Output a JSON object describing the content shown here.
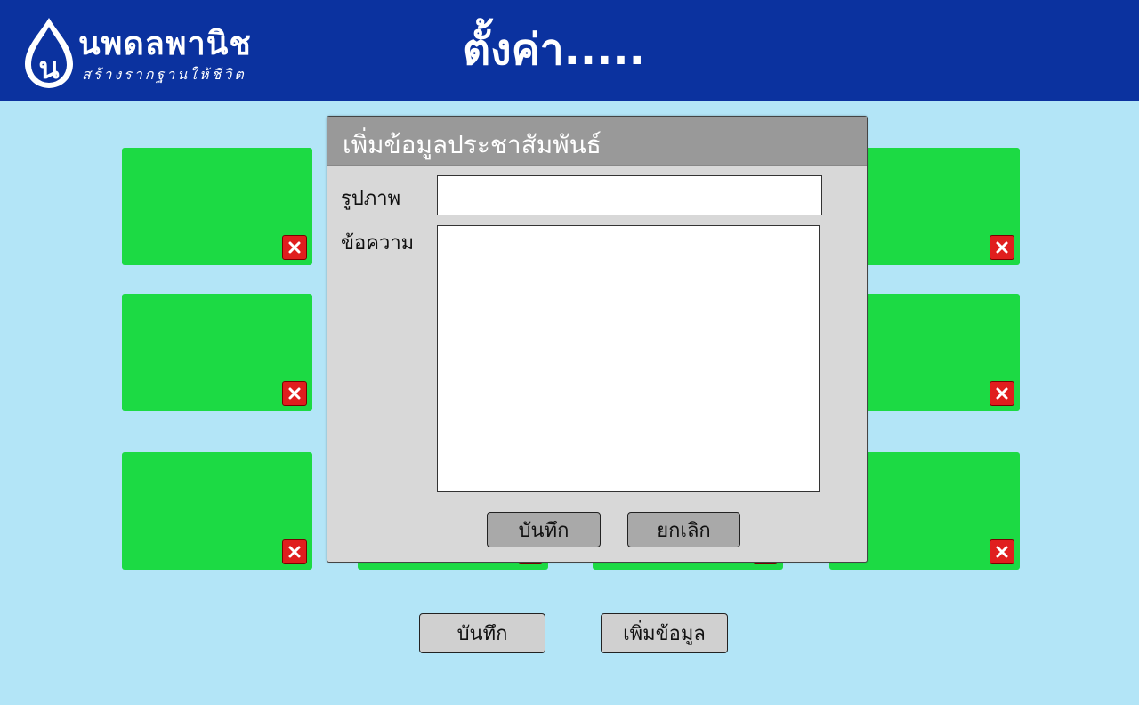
{
  "header": {
    "logo_name": "นพดลพานิช",
    "logo_tagline": "สร้างรากฐานให้ชีวิต",
    "title": "ตั้งค่า....."
  },
  "colors": {
    "header_bg": "#0b329f",
    "page_bg": "#b3e5f7",
    "card": "#1cda44",
    "delete_button": "#e01e1e",
    "dialog_titlebar": "#999999"
  },
  "cards": [
    {
      "delete_icon": "close-icon"
    },
    {
      "delete_icon": "close-icon"
    },
    {
      "delete_icon": "close-icon"
    },
    {
      "delete_icon": "close-icon"
    },
    {
      "delete_icon": "close-icon"
    },
    {
      "delete_icon": "close-icon"
    },
    {
      "delete_icon": "close-icon"
    },
    {
      "delete_icon": "close-icon"
    }
  ],
  "dialog": {
    "title": "เพิ่มข้อมูลประชาสัมพันธ์",
    "image_label": "รูปภาพ",
    "image_value": "",
    "message_label": "ข้อความ",
    "message_value": "",
    "save_label": "บันทึก",
    "cancel_label": "ยกเลิก"
  },
  "footer": {
    "save_label": "บันทึก",
    "add_label": "เพิ่มข้อมูล"
  }
}
